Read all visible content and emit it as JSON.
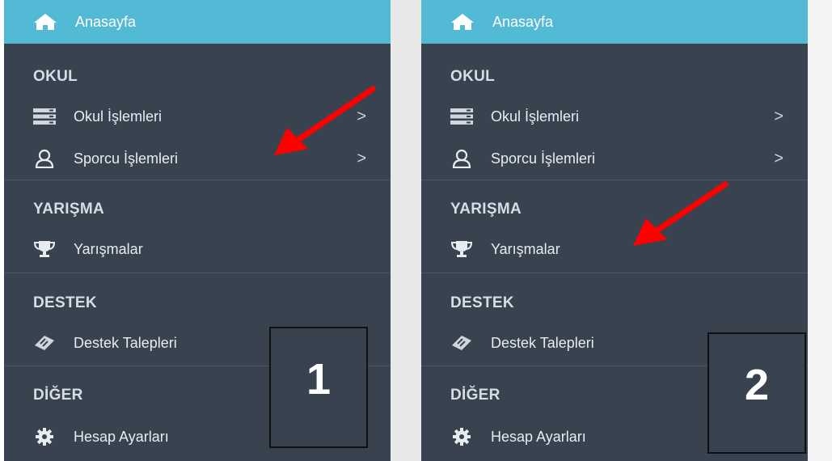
{
  "panels": [
    {
      "home": {
        "label": "Anasayfa",
        "icon": "home-icon"
      },
      "sections": [
        {
          "title": "OKUL",
          "items": [
            {
              "label": "Okul İşlemleri",
              "icon": "server-icon",
              "chevron": ">"
            },
            {
              "label": "Sporcu İşlemleri",
              "icon": "user-icon",
              "chevron": ">"
            }
          ]
        },
        {
          "title": "YARIŞMA",
          "items": [
            {
              "label": "Yarışmalar",
              "icon": "trophy-icon"
            }
          ]
        },
        {
          "title": "DESTEK",
          "items": [
            {
              "label": "Destek Talepleri",
              "icon": "ticket-icon"
            }
          ]
        },
        {
          "title": "DİĞER",
          "items": [
            {
              "label": "Hesap Ayarları",
              "icon": "gear-icon"
            }
          ]
        }
      ],
      "step_number": "1",
      "arrow_target": "Sporcu İşlemleri"
    },
    {
      "home": {
        "label": "Anasayfa",
        "icon": "home-icon"
      },
      "sections": [
        {
          "title": "OKUL",
          "items": [
            {
              "label": "Okul İşlemleri",
              "icon": "server-icon",
              "chevron": ">"
            },
            {
              "label": "Sporcu İşlemleri",
              "icon": "user-icon",
              "chevron": ">"
            }
          ]
        },
        {
          "title": "YARIŞMA",
          "items": [
            {
              "label": "Yarışmalar",
              "icon": "trophy-icon"
            }
          ]
        },
        {
          "title": "DESTEK",
          "items": [
            {
              "label": "Destek Talepleri",
              "icon": "ticket-icon"
            }
          ]
        },
        {
          "title": "DİĞER",
          "items": [
            {
              "label": "Hesap Ayarları",
              "icon": "gear-icon"
            }
          ]
        }
      ],
      "step_number": "2",
      "arrow_target": "Yarışmalar"
    }
  ],
  "colors": {
    "sidebar_bg": "#38434f",
    "home_bg": "#52bad5",
    "arrow": "#ff0000",
    "divider": "#4c5865"
  }
}
